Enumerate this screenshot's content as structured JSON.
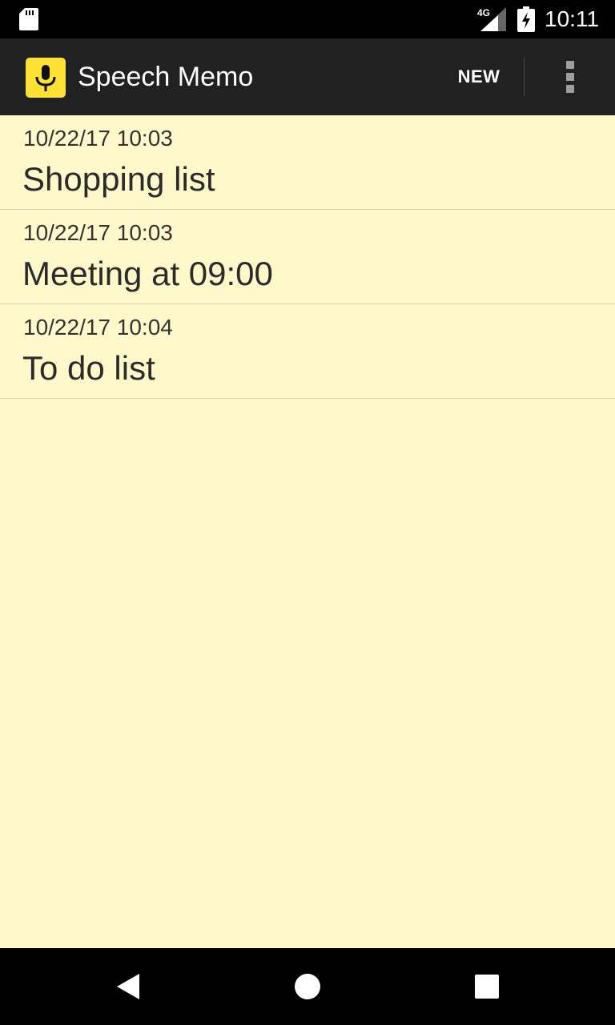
{
  "status_bar": {
    "network_label": "4G",
    "time": "10:11",
    "icons": [
      "sd-card-icon",
      "signal-icon",
      "battery-charging-icon"
    ]
  },
  "app_bar": {
    "icon": "microphone-icon",
    "title": "Speech Memo",
    "new_label": "NEW",
    "overflow_icon": "more-vert-icon"
  },
  "memos": [
    {
      "date": "10/22/17 10:03",
      "title": "Shopping list"
    },
    {
      "date": "10/22/17 10:03",
      "title": "Meeting at 09:00"
    },
    {
      "date": "10/22/17 10:04",
      "title": "To do list"
    }
  ],
  "nav_bar": {
    "buttons": [
      "back-icon",
      "home-icon",
      "recents-icon"
    ]
  },
  "colors": {
    "background": "#FFF8CB",
    "app_bar": "#212121",
    "status_bar": "#000000",
    "app_icon": "#FFE135"
  }
}
